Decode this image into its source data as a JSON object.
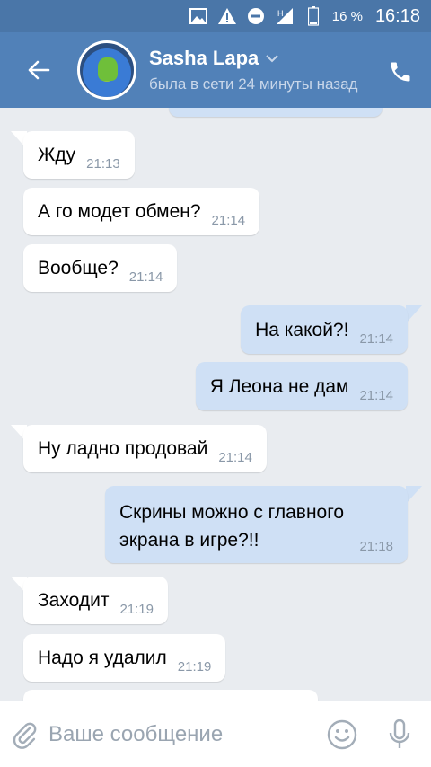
{
  "statusbar": {
    "network_label": "H",
    "battery": "16 %",
    "time": "16:18"
  },
  "header": {
    "contact_name": "Sasha Lapa",
    "status_text": "была в сети 24 минуты назад"
  },
  "messages": [
    {
      "dir": "out",
      "text": "",
      "time": ""
    },
    {
      "dir": "in",
      "text": "Жду",
      "time": "21:13"
    },
    {
      "dir": "in",
      "text": "А го модет обмен?",
      "time": "21:14"
    },
    {
      "dir": "in",
      "text": "Вообще?",
      "time": "21:14"
    },
    {
      "dir": "out",
      "text": "На какой?!",
      "time": "21:14"
    },
    {
      "dir": "out",
      "text": "Я Леона не дам",
      "time": "21:14"
    },
    {
      "dir": "in",
      "text": "Ну ладно продовай",
      "time": "21:14"
    },
    {
      "dir": "out",
      "text_line1": "Скрины можно с главного",
      "text_line2": "экрана в игре?!!",
      "time": "21:18"
    },
    {
      "dir": "in",
      "text": "Заходит",
      "time": "21:19"
    },
    {
      "dir": "in",
      "text": "Надо я удалил",
      "time": "21:19"
    },
    {
      "dir": "in",
      "text": "",
      "time": ""
    }
  ],
  "composer": {
    "placeholder": "Ваше сообщение"
  },
  "colors": {
    "header": "#5181b8",
    "statusbar": "#4a76a8",
    "incoming_bubble": "#ffffff",
    "outgoing_bubble": "#cfe0f5",
    "chat_background": "#e9ecf0"
  }
}
